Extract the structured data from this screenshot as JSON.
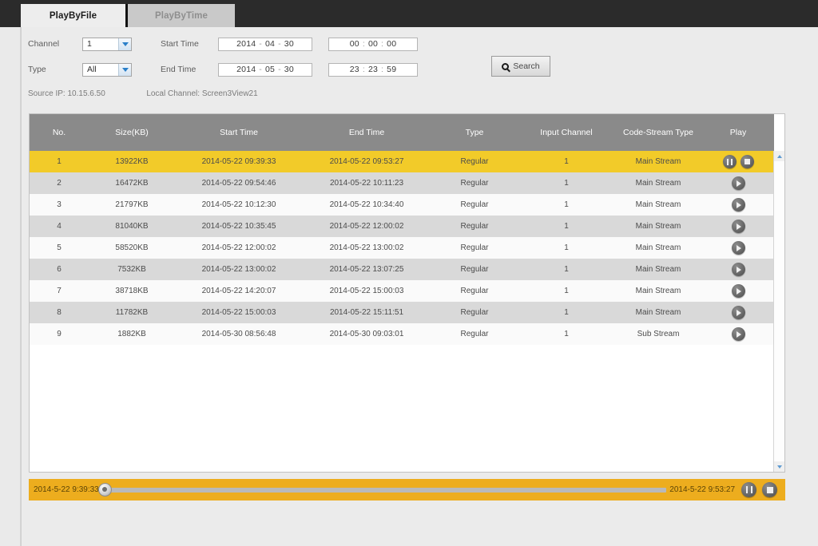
{
  "tabs": [
    {
      "label": "PlayByFile",
      "active": true
    },
    {
      "label": "PlayByTime",
      "active": false
    }
  ],
  "form": {
    "channel_label": "Channel",
    "channel_value": "1",
    "type_label": "Type",
    "type_value": "All",
    "start_time_label": "Start Time",
    "end_time_label": "End Time",
    "start_date": {
      "year": "2014",
      "month": "04",
      "day": "30",
      "sep": "-"
    },
    "start_clock": {
      "hh": "00",
      "mm": "00",
      "ss": "00",
      "sep": ":"
    },
    "end_date": {
      "year": "2014",
      "month": "05",
      "day": "30",
      "sep": "-"
    },
    "end_clock": {
      "hh": "23",
      "mm": "23",
      "ss": "59",
      "sep": ":"
    },
    "search_label": "Search",
    "search_icon": "search-icon"
  },
  "info": {
    "source_ip_label": "Source IP:",
    "source_ip_value": "10.15.6.50",
    "local_channel_label": "Local Channel:",
    "local_channel_value": "Screen3View21"
  },
  "table": {
    "columns": [
      "No.",
      "Size(KB)",
      "Start Time",
      "End Time",
      "Type",
      "Input Channel",
      "Code-Stream Type",
      "Play"
    ],
    "rows": [
      {
        "no": "1",
        "size": "13922KB",
        "start": "2014-05-22 09:39:33",
        "end": "2014-05-22 09:53:27",
        "type": "Regular",
        "input_channel": "1",
        "code_stream": "Main Stream",
        "selected": true,
        "controls": [
          "pause-icon",
          "stop-icon"
        ]
      },
      {
        "no": "2",
        "size": "16472KB",
        "start": "2014-05-22 09:54:46",
        "end": "2014-05-22 10:11:23",
        "type": "Regular",
        "input_channel": "1",
        "code_stream": "Main Stream",
        "selected": false,
        "controls": [
          "play-icon"
        ]
      },
      {
        "no": "3",
        "size": "21797KB",
        "start": "2014-05-22 10:12:30",
        "end": "2014-05-22 10:34:40",
        "type": "Regular",
        "input_channel": "1",
        "code_stream": "Main Stream",
        "selected": false,
        "controls": [
          "play-icon"
        ]
      },
      {
        "no": "4",
        "size": "81040KB",
        "start": "2014-05-22 10:35:45",
        "end": "2014-05-22 12:00:02",
        "type": "Regular",
        "input_channel": "1",
        "code_stream": "Main Stream",
        "selected": false,
        "controls": [
          "play-icon"
        ]
      },
      {
        "no": "5",
        "size": "58520KB",
        "start": "2014-05-22 12:00:02",
        "end": "2014-05-22 13:00:02",
        "type": "Regular",
        "input_channel": "1",
        "code_stream": "Main Stream",
        "selected": false,
        "controls": [
          "play-icon"
        ]
      },
      {
        "no": "6",
        "size": "7532KB",
        "start": "2014-05-22 13:00:02",
        "end": "2014-05-22 13:07:25",
        "type": "Regular",
        "input_channel": "1",
        "code_stream": "Main Stream",
        "selected": false,
        "controls": [
          "play-icon"
        ]
      },
      {
        "no": "7",
        "size": "38718KB",
        "start": "2014-05-22 14:20:07",
        "end": "2014-05-22 15:00:03",
        "type": "Regular",
        "input_channel": "1",
        "code_stream": "Main Stream",
        "selected": false,
        "controls": [
          "play-icon"
        ]
      },
      {
        "no": "8",
        "size": "11782KB",
        "start": "2014-05-22 15:00:03",
        "end": "2014-05-22 15:11:51",
        "type": "Regular",
        "input_channel": "1",
        "code_stream": "Main Stream",
        "selected": false,
        "controls": [
          "play-icon"
        ]
      },
      {
        "no": "9",
        "size": "1882KB",
        "start": "2014-05-30 08:56:48",
        "end": "2014-05-30 09:03:01",
        "type": "Regular",
        "input_channel": "1",
        "code_stream": "Sub Stream",
        "selected": false,
        "controls": [
          "play-icon"
        ]
      }
    ]
  },
  "playback": {
    "start_time": "2014-5-22 9:39:33",
    "end_time": "2014-5-22 9:53:27",
    "progress_percent": 0,
    "pause_icon": "pause-icon",
    "stop_icon": "stop-icon"
  },
  "colors": {
    "accent": "#edad1e",
    "selected_row": "#f2cb29",
    "header_gray": "#8a8a8a",
    "tab_dark": "#2b2b2b"
  }
}
